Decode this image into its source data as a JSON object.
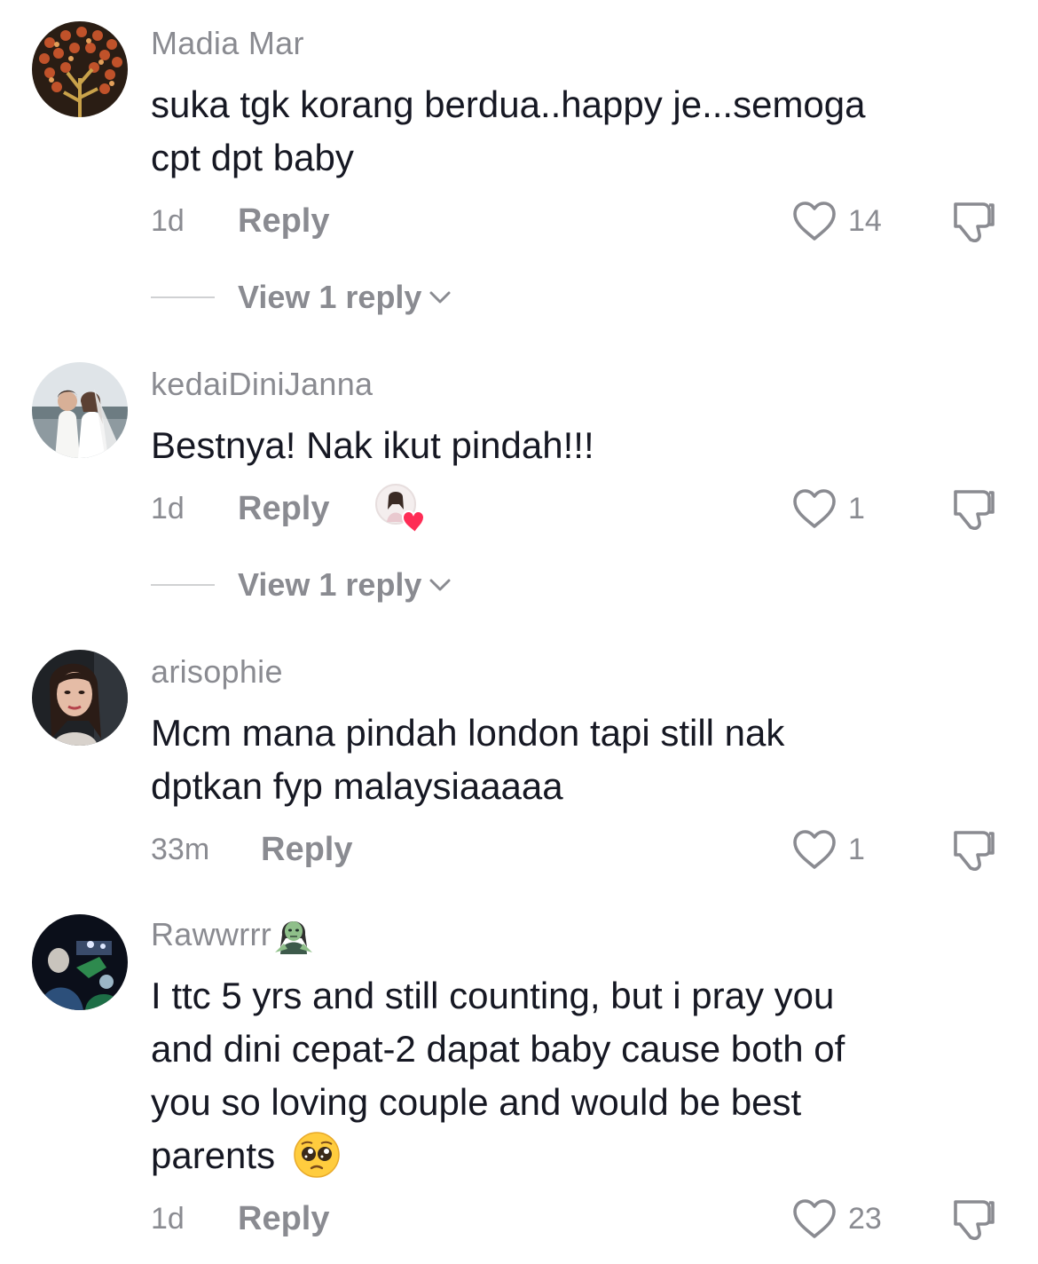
{
  "comments": [
    {
      "username": "Madia Mar",
      "text_lines": [
        "suka tgk korang berdua..happy je...semoga",
        "cpt dpt baby"
      ],
      "time": "1d",
      "reply_label": "Reply",
      "likes": "14",
      "view_replies": "View 1 reply",
      "avatar_icon": "tree-pattern-avatar"
    },
    {
      "username": "kedaiDiniJanna",
      "text_lines": [
        "Bestnya! Nak ikut pindah!!!"
      ],
      "time": "1d",
      "reply_label": "Reply",
      "likes": "1",
      "view_replies": "View 1 reply",
      "creator_liked": true,
      "avatar_icon": "wedding-couple-avatar"
    },
    {
      "username": "arisophie",
      "text_lines": [
        "Mcm mana pindah london tapi still nak",
        "dptkan fyp malaysiaaaaa"
      ],
      "time": "33m",
      "reply_label": "Reply",
      "likes": "1",
      "avatar_icon": "woman-portrait-avatar"
    },
    {
      "username": "Rawwrrr",
      "username_emoji": "zombie-woman-emoji",
      "text_lines": [
        "I ttc 5 yrs and still counting, but i pray you",
        "and dini cepat-2 dapat baby cause both of",
        "you so loving couple and would be best",
        "parents"
      ],
      "text_emoji": "pleading-face-emoji",
      "time": "1d",
      "reply_label": "Reply",
      "likes": "23",
      "avatar_icon": "concert-night-avatar"
    }
  ],
  "colors": {
    "text": "#161823",
    "secondary": "#8a8b91",
    "heart_badge": "#fe2c55"
  }
}
